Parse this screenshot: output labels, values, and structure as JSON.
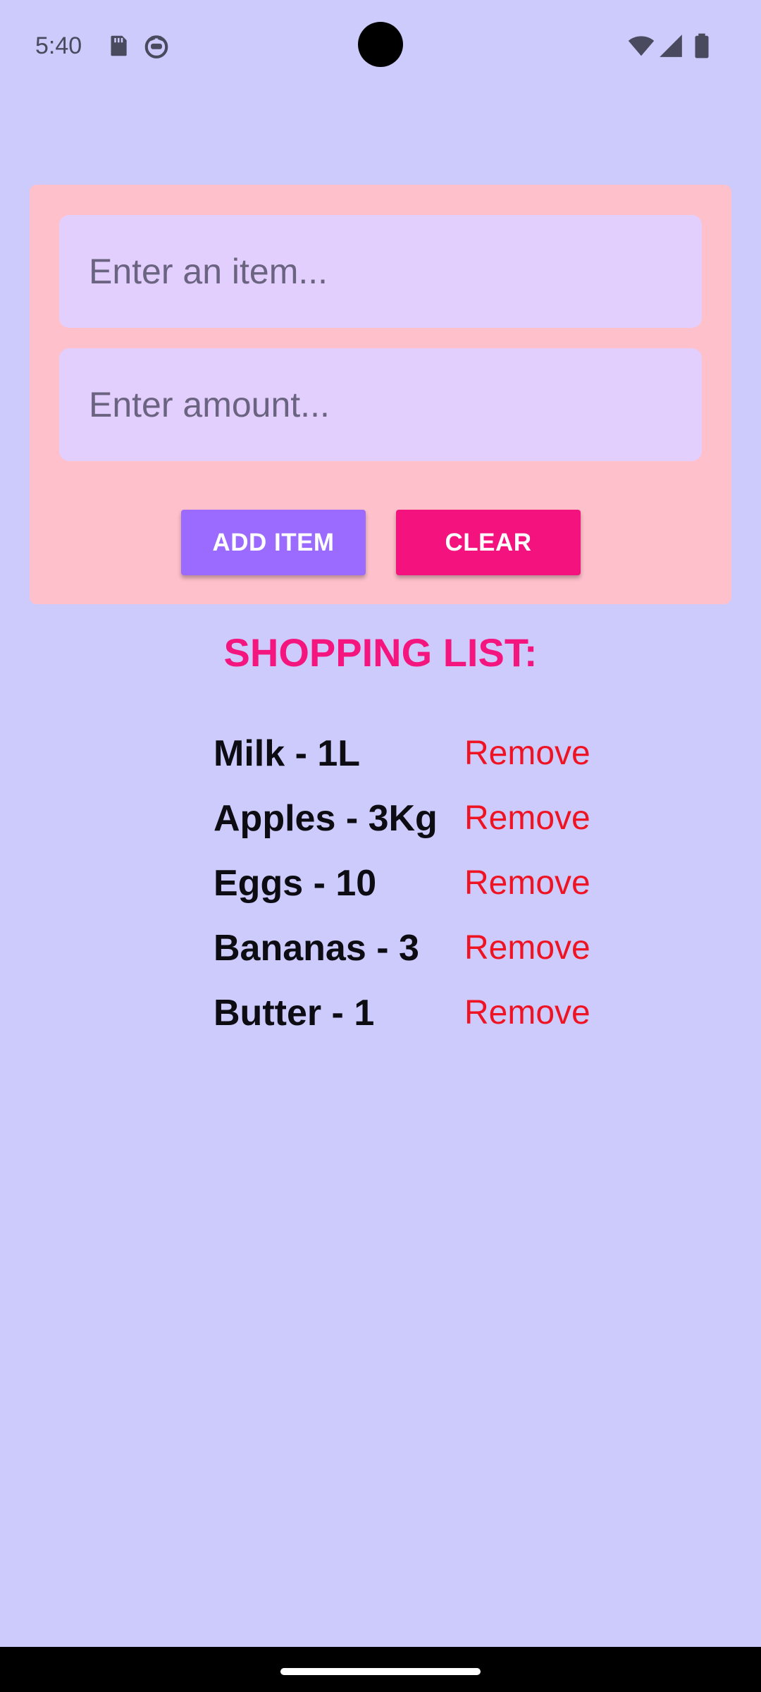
{
  "status_bar": {
    "time": "5:40",
    "icons": [
      "sd-card-icon",
      "app-notification-icon",
      "wifi-icon",
      "cellular-signal-icon",
      "battery-icon"
    ]
  },
  "form": {
    "item_placeholder": "Enter an item...",
    "amount_placeholder": "Enter amount...",
    "add_button": "ADD ITEM",
    "clear_button": "CLEAR"
  },
  "list": {
    "heading": "SHOPPING LIST:",
    "remove_label": "Remove",
    "items": [
      {
        "label": "Milk - 1L"
      },
      {
        "label": "Apples - 3Kg"
      },
      {
        "label": "Eggs - 10"
      },
      {
        "label": "Bananas - 3"
      },
      {
        "label": "Butter - 1"
      }
    ]
  },
  "colors": {
    "background": "#cccbfc",
    "card": "#fec0cb",
    "field": "#e2cffe",
    "add_button": "#9a6bfe",
    "clear_button": "#f4127f",
    "heading": "#f5157f",
    "remove": "#ef1424"
  }
}
